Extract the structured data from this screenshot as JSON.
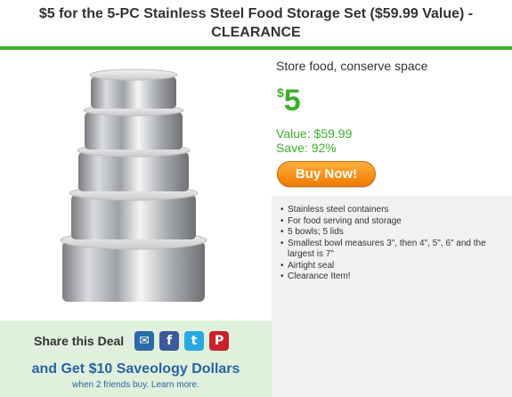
{
  "header": {
    "title": "$5 for the 5-PC Stainless Steel Food Storage Set ($59.99 Value) - CLEARANCE"
  },
  "deal": {
    "tagline": "Store food, conserve space",
    "price_currency": "$",
    "price": "5",
    "value_text": "Value: $59.99",
    "save_text": "Save: 92%",
    "buy_label": "Buy Now!"
  },
  "details": {
    "items": [
      "Stainless steel containers",
      "For food serving and storage",
      "5 bowls; 5 lids",
      "Smallest bowl measures 3\", then 4\", 5\", 6\" and the largest is 7\"",
      "Airtight seal",
      "Clearance Item!"
    ]
  },
  "share": {
    "label": "Share this Deal",
    "icons": [
      "email-icon",
      "facebook-icon",
      "twitter-icon",
      "pinterest-icon"
    ],
    "facebook_glyph": "f",
    "twitter_glyph": "t",
    "pinterest_glyph": "P",
    "savings_line": "and Get $10 Saveology Dollars",
    "savings_sub": "when 2 friends buy. Learn more."
  },
  "colors": {
    "accent_green": "#3daf2c",
    "buy_orange": "#f07a00",
    "link_blue": "#2a62a6"
  }
}
